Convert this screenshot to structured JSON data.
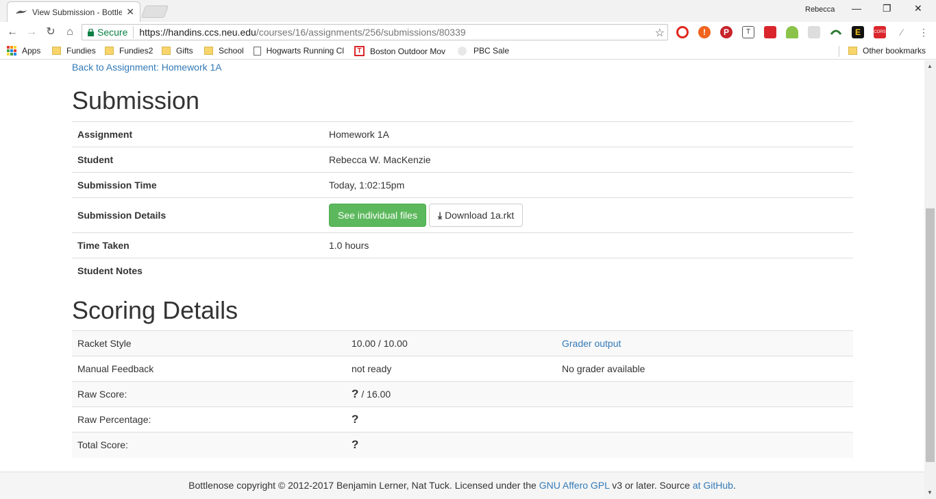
{
  "browser": {
    "tab_title": "View Submission - Bottle",
    "profile_name": "Rebecca",
    "secure_label": "Secure",
    "url_scheme_host": "https://handins.ccs.neu.edu",
    "url_path": "/courses/16/assignments/256/submissions/80339",
    "bookmarks": {
      "apps": "Apps",
      "fundies": "Fundies",
      "fundies2": "Fundies2",
      "gifts": "Gifts",
      "school": "School",
      "hogwarts": "Hogwarts Running Cl",
      "boston": "Boston Outdoor Mov",
      "pbc": "PBC Sale",
      "other": "Other bookmarks"
    },
    "extension_colors": {
      "opera": "#e0261c",
      "alert": "#f0641e",
      "pinterest": "#c8232c",
      "dice": "#d9262c",
      "cors": "#d9262c"
    }
  },
  "page": {
    "back_link": "Back to Assignment: Homework 1A",
    "submission_heading": "Submission",
    "details": {
      "assignment_label": "Assignment",
      "assignment_value": "Homework 1A",
      "student_label": "Student",
      "student_value": "Rebecca W. MacKenzie",
      "time_label": "Submission Time",
      "time_value": "Today, 1:02:15pm",
      "details_label": "Submission Details",
      "see_files_button": "See individual files",
      "download_button": "Download 1a.rkt",
      "taken_label": "Time Taken",
      "taken_value": "1.0 hours",
      "notes_label": "Student Notes",
      "notes_value": ""
    },
    "scoring_heading": "Scoring Details",
    "scoring": {
      "racket_label": "Racket Style",
      "racket_score": "10.00 / 10.00",
      "racket_link": "Grader output",
      "manual_label": "Manual Feedback",
      "manual_score": "not ready",
      "manual_note": "No grader available",
      "raw_label": "Raw Score:",
      "raw_value": "?",
      "raw_total": "/ 16.00",
      "pct_label": "Raw Percentage:",
      "pct_value": "?",
      "total_label": "Total Score:",
      "total_value": "?"
    },
    "footer": {
      "prefix": "Bottlenose copyright © 2012-2017 Benjamin Lerner, Nat Tuck. Licensed under the",
      "license_link": "GNU Affero GPL",
      "middle": "v3 or later. Source",
      "source_link": "at GitHub",
      "suffix": "."
    }
  }
}
